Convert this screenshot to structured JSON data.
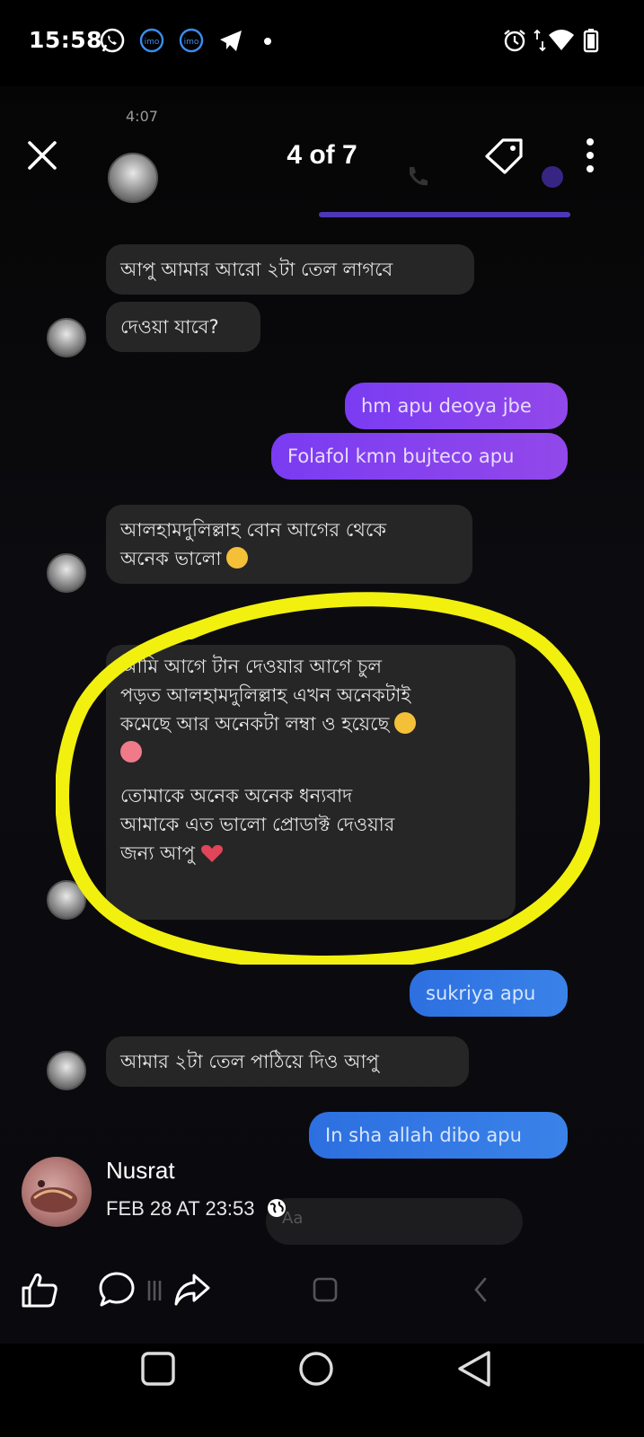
{
  "status_bar": {
    "time": "15:58",
    "icons": [
      "whatsapp-icon",
      "imo-icon",
      "imo-icon",
      "telegram-icon",
      "notification-dot",
      "alarm-icon",
      "data-arrows-icon",
      "wifi-icon",
      "battery-icon"
    ],
    "imo_label": "imo"
  },
  "viewer": {
    "counter": "4 of 7",
    "close_icon": "close-icon",
    "tag_icon": "tag-icon",
    "more_icon": "more-vertical-icon"
  },
  "screenshot": {
    "phone_time": "4:07",
    "messages": [
      {
        "side": "in",
        "text": "আপু আমার আরো ২টা তেল লাগবে"
      },
      {
        "side": "in",
        "text": "দেওয়া যাবে?"
      },
      {
        "side": "out",
        "text": "hm apu deoya jbe"
      },
      {
        "side": "out",
        "text": "Folafol kmn bujteco apu"
      },
      {
        "side": "in",
        "lines": [
          "আলহামদুলিল্লাহ বোন আগের থেকে",
          "অনেক ভালো"
        ]
      },
      {
        "side": "in",
        "lines": [
          "আমি আগে টান দেওয়ার আগে চুল",
          "পড়ত আলহামদুলিল্লাহ এখন অনেকটাই",
          "কমেছে আর অনেকটা লম্বা ও হয়েছে",
          "",
          "তোমাকে অনেক অনেক ধন্যবাদ",
          "আমাকে এত ভালো প্রোডাক্ট দেওয়ার",
          "জন্য আপু"
        ]
      },
      {
        "side": "out",
        "text": "sukriya apu"
      },
      {
        "side": "in",
        "text": "আমার ২টা তেল পাঠিয়ে দিও আপু"
      },
      {
        "side": "out",
        "text": "In sha allah dibo apu"
      }
    ],
    "input_placeholder": "Aa"
  },
  "caption": {
    "author": "Nusrat",
    "timestamp": "FEB 28 AT 23:53",
    "privacy_icon": "globe-icon"
  },
  "actions": [
    "like-icon",
    "comment-icon",
    "share-icon"
  ],
  "navigation": [
    "recents-icon",
    "home-icon",
    "back-icon"
  ],
  "colors": {
    "highlight_ring": "#f2f00f",
    "outgoing_purple": "#8442ee",
    "outgoing_blue": "#3278e4",
    "incoming": "#262626"
  }
}
